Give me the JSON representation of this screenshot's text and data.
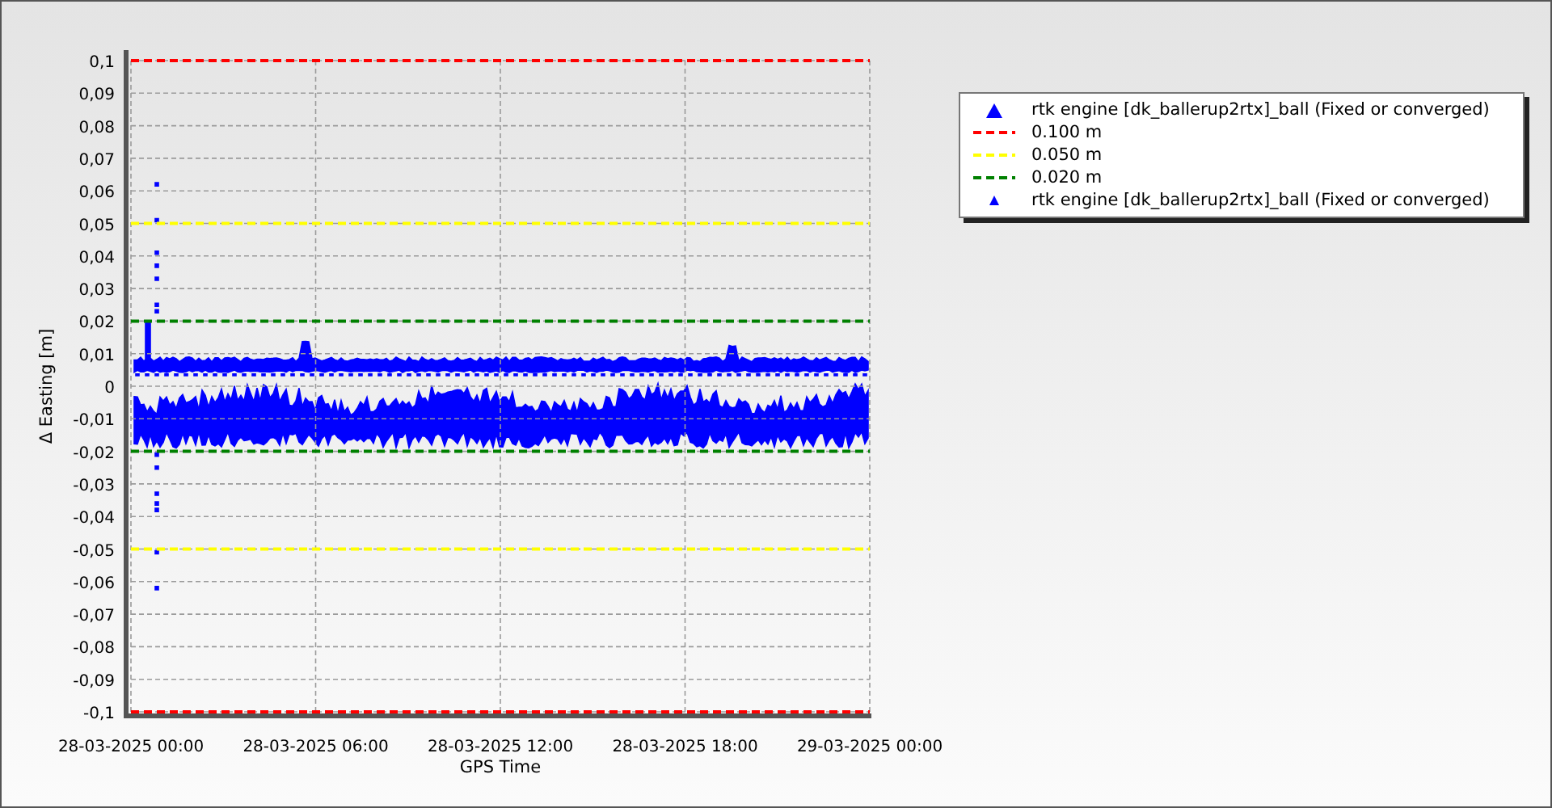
{
  "chart": {
    "chart_data": {
      "type": "line",
      "grid": true,
      "ylabel": "Δ Easting [m]",
      "xlabel": "GPS Time",
      "categories": [
        "28-03-2025 00:00",
        "28-03-2025 06:00",
        "28-03-2025 12:00",
        "28-03-2025 18:00",
        "29-03-2025 00:00"
      ],
      "ylim": [
        -0.1,
        0.1
      ],
      "yticks": [
        {
          "value": 0.1,
          "label": "0,1"
        },
        {
          "value": 0.09,
          "label": "0,09"
        },
        {
          "value": 0.08,
          "label": "0,08"
        },
        {
          "value": 0.07,
          "label": "0,07"
        },
        {
          "value": 0.06,
          "label": "0,06"
        },
        {
          "value": 0.05,
          "label": "0,05"
        },
        {
          "value": 0.04,
          "label": "0,04"
        },
        {
          "value": 0.03,
          "label": "0,03"
        },
        {
          "value": 0.02,
          "label": "0,02"
        },
        {
          "value": 0.01,
          "label": "0,01"
        },
        {
          "value": 0,
          "label": "0"
        },
        {
          "value": -0.01,
          "label": "-0,01"
        },
        {
          "value": -0.02,
          "label": "-0,02"
        },
        {
          "value": -0.03,
          "label": "-0,03"
        },
        {
          "value": -0.04,
          "label": "-0,04"
        },
        {
          "value": -0.05,
          "label": "-0,05"
        },
        {
          "value": -0.06,
          "label": "-0,06"
        },
        {
          "value": -0.07,
          "label": "-0,07"
        },
        {
          "value": -0.08,
          "label": "-0,08"
        },
        {
          "value": -0.09,
          "label": "-0,09"
        },
        {
          "value": -0.1,
          "label": "-0,1"
        }
      ],
      "series": [
        {
          "name": "0.100 m",
          "color": "#ff0000",
          "line_style": "dashed",
          "values": [
            0.1,
            0.1,
            0.1,
            0.1,
            0.1
          ]
        },
        {
          "name": "0.050 m",
          "color": "#ffff00",
          "line_style": "dashed",
          "values": [
            0.05,
            0.05,
            0.05,
            0.05,
            0.05
          ]
        },
        {
          "name": "0.020 m",
          "color": "#008000",
          "line_style": "dashed",
          "values": [
            0.02,
            0.02,
            0.02,
            0.02,
            0.02
          ]
        }
      ],
      "ref_lines": [
        {
          "axis": "y",
          "value": -0.1,
          "color": "#ff0000",
          "line_style": "dashed"
        },
        {
          "axis": "y",
          "value": -0.05,
          "color": "#ffff00",
          "line_style": "dashed"
        },
        {
          "axis": "y",
          "value": -0.02,
          "color": "#008000",
          "line_style": "dashed"
        }
      ]
    }
  },
  "legend": {
    "marker_entries": [
      {
        "kind": "marker",
        "label": "rtk engine [dk_ballerup2rtx]_ball (Fixed or converged)",
        "color": "#0000ff"
      },
      {
        "kind": "point",
        "label": "rtk engine [dk_ballerup2rtx]_ball (Fixed or converged)",
        "color": "#0000ff"
      }
    ]
  }
}
